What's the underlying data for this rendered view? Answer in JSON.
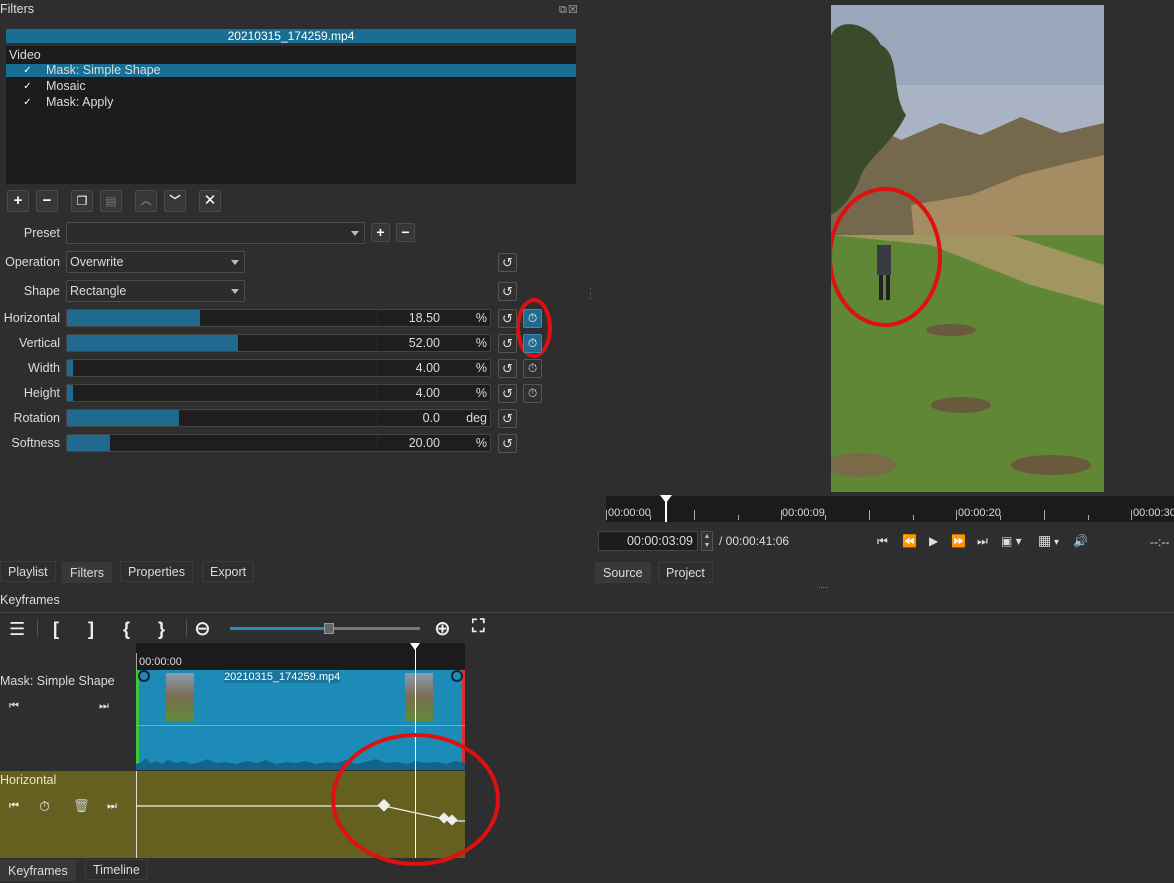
{
  "filters_panel": {
    "title": "Filters",
    "clip_name": "20210315_174259.mp4",
    "list_header": "Video",
    "filters": [
      {
        "name": "Mask: Simple Shape",
        "checked": true,
        "selected": true
      },
      {
        "name": "Mosaic",
        "checked": true,
        "selected": false
      },
      {
        "name": "Mask: Apply",
        "checked": true,
        "selected": false
      }
    ],
    "preset_label": "Preset",
    "preset_value": "",
    "operation_label": "Operation",
    "operation_value": "Overwrite",
    "shape_label": "Shape",
    "shape_value": "Rectangle",
    "params": [
      {
        "label": "Horizontal",
        "value": "18.50",
        "unit": "%",
        "fill": 0.43,
        "keyframes": true
      },
      {
        "label": "Vertical",
        "value": "52.00",
        "unit": "%",
        "fill": 0.55,
        "keyframes": true
      },
      {
        "label": "Width",
        "value": "4.00",
        "unit": "%",
        "fill": 0.02,
        "keyframes": false
      },
      {
        "label": "Height",
        "value": "4.00",
        "unit": "%",
        "fill": 0.02,
        "keyframes": false
      },
      {
        "label": "Rotation",
        "value": "0.0",
        "unit": "deg",
        "fill": 0.36,
        "keyframes": null
      },
      {
        "label": "Softness",
        "value": "20.00",
        "unit": "%",
        "fill": 0.14,
        "keyframes": null
      }
    ]
  },
  "left_tabs": [
    "Playlist",
    "Filters",
    "Properties",
    "Export"
  ],
  "right_tabs": [
    "Source",
    "Project"
  ],
  "player": {
    "ruler_labels": [
      "00:00:00",
      "00:00:09",
      "00:00:20",
      "00:00:30"
    ],
    "position": "00:00:03:09",
    "duration": "/ 00:00:41:06",
    "right_time": "--:--"
  },
  "keyframes_panel": {
    "title": "Keyframes",
    "ruler_time": "00:00:00",
    "clip_track_label": "Mask: Simple Shape",
    "clip_name": "20210315_174259.mp4",
    "param_track_label": "Horizontal",
    "zoom_level": 0.63
  },
  "bottom_tabs": [
    "Keyframes",
    "Timeline"
  ],
  "colors": {
    "accent": "#196f93",
    "highlight": "#e01010",
    "param_track": "#656020",
    "clip_track": "#1d8bb8"
  }
}
